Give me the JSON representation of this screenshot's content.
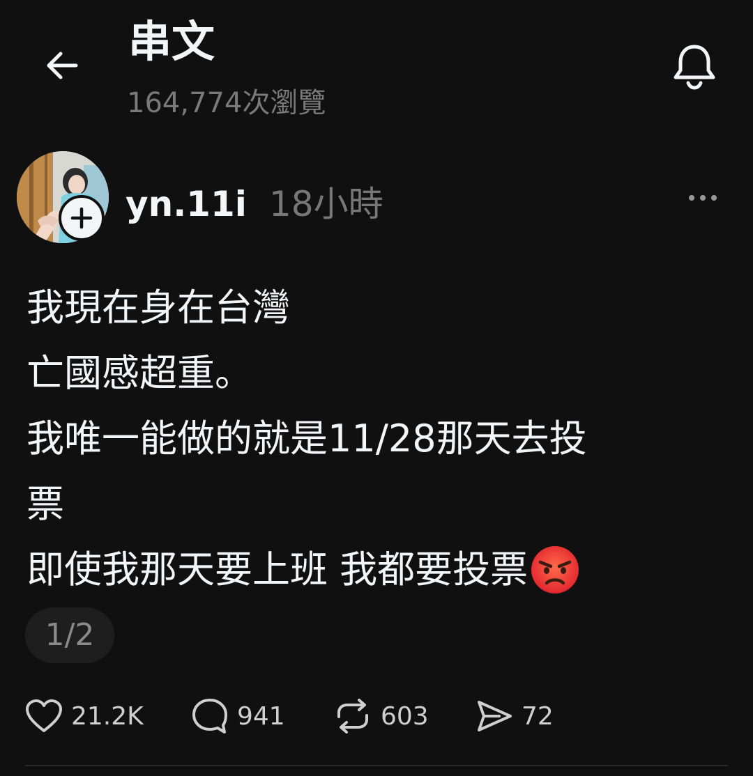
{
  "header": {
    "title": "串文",
    "views": "164,774次瀏覽",
    "back_icon": "back-arrow-icon",
    "notify_icon": "bell-icon"
  },
  "post": {
    "username": "yn.11i",
    "time": "18小時",
    "more_icon": "more-horizontal-icon",
    "lines": [
      "我現在身在台灣",
      "亡國感超重。",
      "我唯一能做的就是11/28那天去投",
      "票",
      "即使我那天要上班 我都要投票"
    ],
    "emoji": "angry-face",
    "pagination": "1/2",
    "actions": {
      "likes": "21.2K",
      "comments": "941",
      "reposts": "603",
      "shares": "72"
    }
  },
  "colors": {
    "background": "#101010",
    "text": "#f3f5f7",
    "muted": "#777777",
    "pill": "#1e1e1e"
  }
}
